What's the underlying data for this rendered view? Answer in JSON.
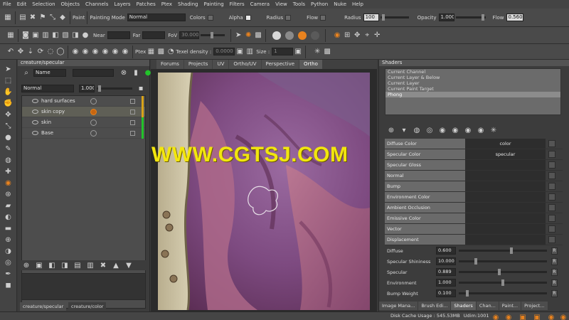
{
  "menu": [
    "File",
    "Edit",
    "Selection",
    "Objects",
    "Channels",
    "Layers",
    "Patches",
    "Ptex",
    "Shading",
    "Painting",
    "Filters",
    "Camera",
    "View",
    "Tools",
    "Python",
    "Nuke",
    "Help"
  ],
  "toolbar1": {
    "paint_label": "Paint",
    "mode_label": "Painting Mode",
    "mode_value": "Normal",
    "colors_label": "Colors",
    "alpha_label": "Alpha",
    "radius_toggle_label": "Radius",
    "flow_toggle_label": "Flow",
    "radius_label": "Radius",
    "radius_value": "100",
    "opacity_label": "Opacity",
    "opacity_value": "1.000",
    "flow_label": "Flow",
    "flow_value": "0.560"
  },
  "toolbar2": {
    "near_label": "Near",
    "far_label": "Far",
    "fov_label": "FoV",
    "fov_value": "30.000"
  },
  "toolbar3": {
    "ptex_label": "Ptex",
    "texel_label": "Texel density :",
    "texel_value": "0.0000",
    "size_label": "Size :",
    "size_value": "1"
  },
  "layers": {
    "title": "creature/specular",
    "filter_mode": "Name",
    "blend_mode": "Normal",
    "opacity": "1.000",
    "items": [
      {
        "name": "hard surfaces",
        "selected": false,
        "bar_color": "#d8a31a"
      },
      {
        "name": "skin copy",
        "selected": true,
        "bar_color": "#d8a31a"
      },
      {
        "name": "skin",
        "selected": false,
        "bar_color": "#22c32a"
      },
      {
        "name": "Base",
        "selected": false,
        "bar_color": "#22c32a"
      }
    ],
    "bottom_tabs": [
      "creature/specular",
      "creature/color"
    ]
  },
  "viewport": {
    "tabs": [
      "Forums",
      "Projects",
      "UV",
      "Ortho/UV",
      "Perspective",
      "Ortho"
    ],
    "active_tab": "Ortho"
  },
  "watermark": "WWW.CGTSJ.COM",
  "shaders": {
    "title": "Shaders",
    "list": [
      "Current Channel",
      "Current Layer & Below",
      "Current Layer",
      "Current Paint Target",
      "Phong"
    ],
    "selected": "Phong",
    "props": [
      {
        "label": "Diffuse Color",
        "value": "color"
      },
      {
        "label": "Specular Color",
        "value": "specular"
      },
      {
        "label": "Specular Gloss",
        "value": ""
      },
      {
        "label": "Normal",
        "value": ""
      },
      {
        "label": "Bump",
        "value": ""
      },
      {
        "label": "Environment Color",
        "value": ""
      },
      {
        "label": "Ambient Occlusion",
        "value": ""
      },
      {
        "label": "Emissive Color",
        "value": ""
      },
      {
        "label": "Vector",
        "value": ""
      },
      {
        "label": "Displacement",
        "value": ""
      }
    ],
    "sliders": [
      {
        "label": "Diffuse",
        "value": "0.600",
        "fraction": 0.6
      },
      {
        "label": "Specular Shininess",
        "value": "10.000",
        "fraction": 0.18
      },
      {
        "label": "Specular",
        "value": "0.889",
        "fraction": 0.46
      },
      {
        "label": "Environment",
        "value": "1.000",
        "fraction": 0.5
      },
      {
        "label": "Bump Weight",
        "value": "0.100",
        "fraction": 0.08
      }
    ],
    "reset_label": "R",
    "bottom_tabs": [
      "Image Mana...",
      "Brush Edi...",
      "Shaders",
      "Chan...",
      "Paint...",
      "Project..."
    ],
    "active_bottom_tab": "Shaders"
  },
  "status": {
    "disk_cache_label": "Disk Cache Usage :",
    "disk_cache_value": "545.53MB",
    "udim_label": "Udim:",
    "udim_value": "1001"
  }
}
